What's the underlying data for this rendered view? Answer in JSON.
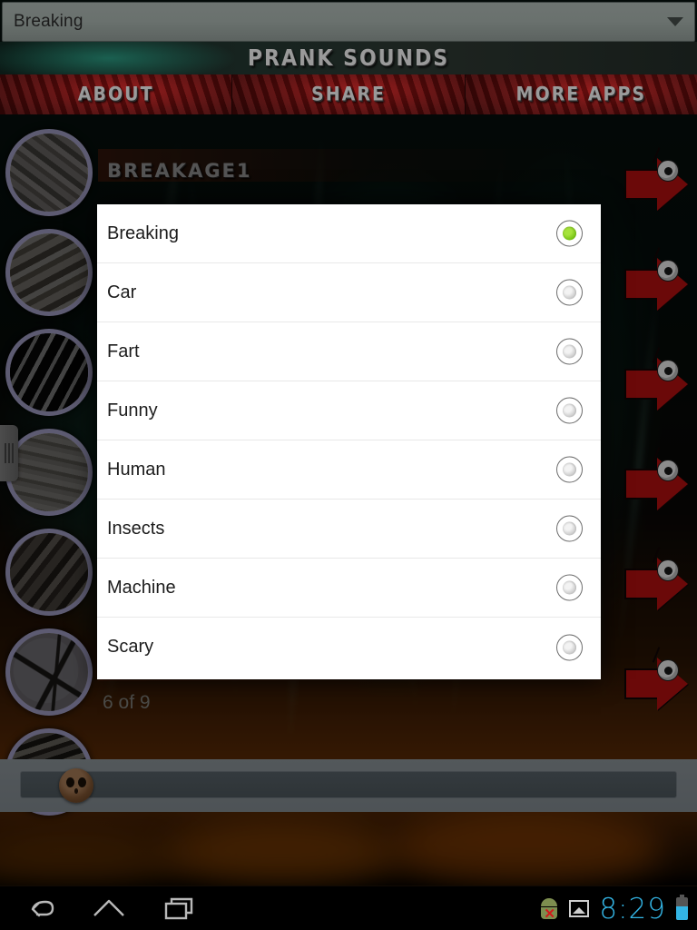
{
  "spinner": {
    "selected_value": "Breaking",
    "caret_icon": "chevron-down-icon"
  },
  "banner": {
    "title": "PRANK SOUNDS"
  },
  "menu": {
    "items": [
      {
        "label": "ABOUT",
        "name": "about"
      },
      {
        "label": "SHARE",
        "name": "share"
      },
      {
        "label": "MORE APPS",
        "name": "more-apps"
      }
    ]
  },
  "list": {
    "page_counter": "6 of 9",
    "rows": [
      {
        "name": "BREAKAGE1"
      },
      {
        "name": ""
      },
      {
        "name": ""
      },
      {
        "name": ""
      },
      {
        "name": ""
      },
      {
        "name": ""
      }
    ]
  },
  "seekbar": {
    "thumb_icon": "skull-thumb",
    "value_percent": 4
  },
  "dialog": {
    "selected": "Breaking",
    "options": [
      {
        "label": "Breaking",
        "selected": true
      },
      {
        "label": "Car",
        "selected": false
      },
      {
        "label": "Fart",
        "selected": false
      },
      {
        "label": "Funny",
        "selected": false
      },
      {
        "label": "Human",
        "selected": false
      },
      {
        "label": "Insects",
        "selected": false
      },
      {
        "label": "Machine",
        "selected": false
      },
      {
        "label": "Scary",
        "selected": false
      }
    ]
  },
  "navbar": {
    "back_icon": "back-arrow-icon",
    "home_icon": "home-icon",
    "recents_icon": "recent-apps-icon",
    "status": {
      "android_icon": "android-error-icon",
      "screenshot_icon": "screenshot-icon",
      "clock": "8:29",
      "battery_icon": "battery-icon"
    }
  },
  "colors": {
    "accent_green": "#76c314",
    "clock_cyan": "#33b5e5",
    "menu_red": "#8e1212",
    "arrow_red": "#c41212",
    "thumb_ring": "#a9a6cf"
  }
}
